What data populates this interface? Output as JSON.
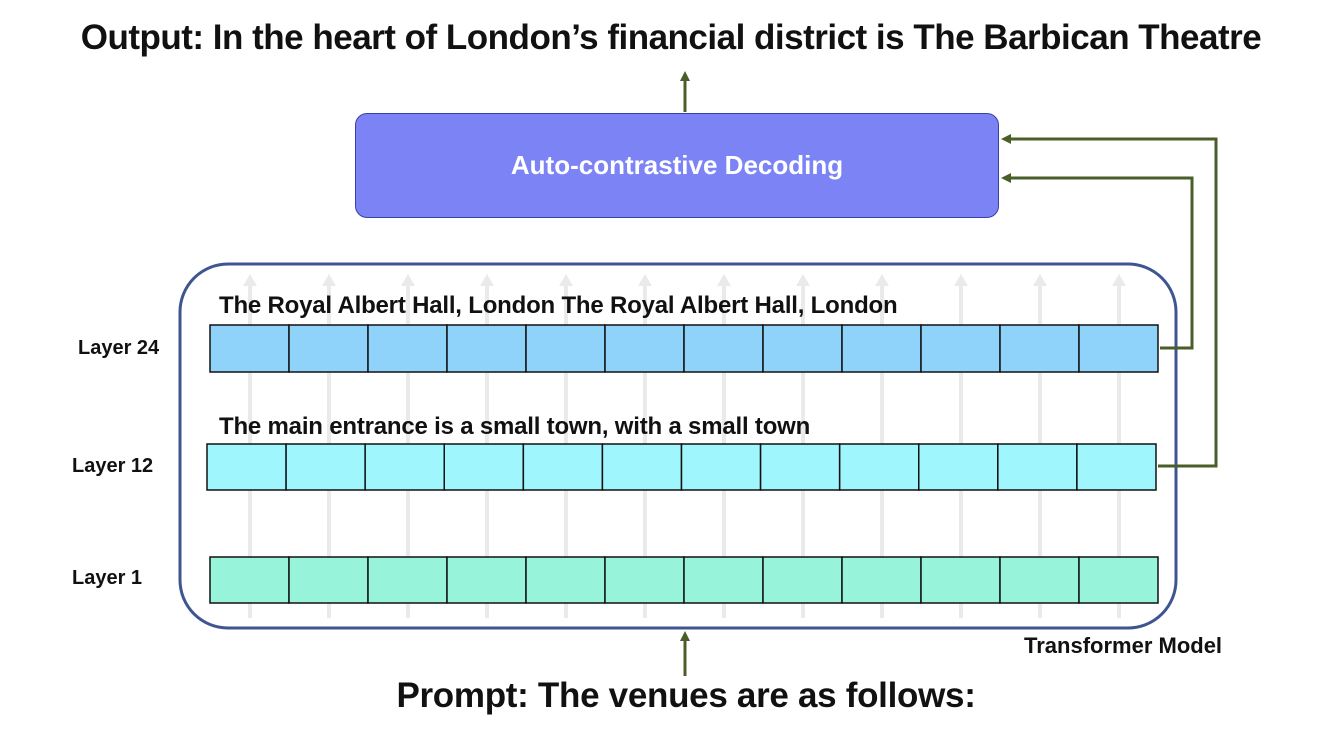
{
  "output_title": "Output: In the heart of London’s financial district is The Barbican Theatre",
  "prompt": "Prompt: The venues are as follows:",
  "decoder_label": "Auto-contrastive Decoding",
  "model_label": "Transformer Model",
  "layers": [
    {
      "label": "Layer 24",
      "text": "The Royal Albert Hall, London The Royal Albert Hall, London",
      "color": "#8fd3fb",
      "cells": 12
    },
    {
      "label": "Layer 12",
      "text": "The main entrance is a small town, with a small town",
      "color": "#a0f6fd",
      "cells": 12
    },
    {
      "label": "Layer 1",
      "text": "",
      "color": "#97f4da",
      "cells": 12
    }
  ],
  "colors": {
    "arrow": "#4a5e2a",
    "model_border": "#3e5590",
    "decoder_fill": "#7c83f5",
    "decoder_border": "#3b40a8",
    "faint_arrow": "#eaeaea"
  }
}
